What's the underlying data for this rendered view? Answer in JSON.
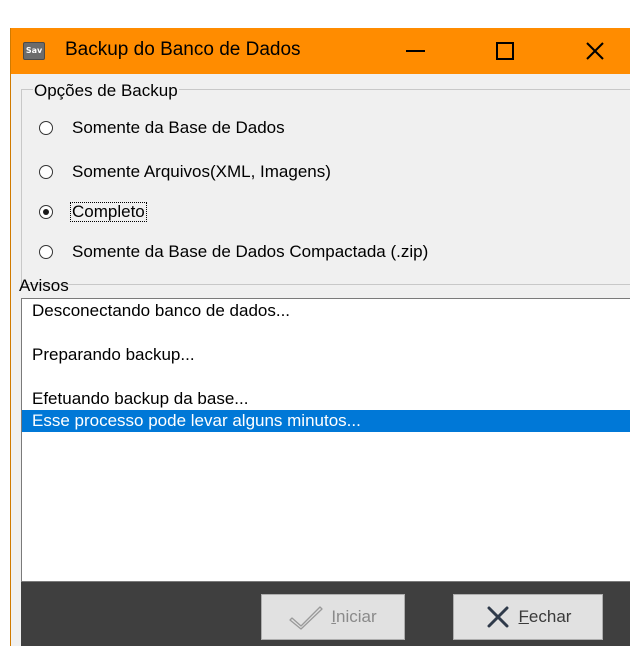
{
  "window": {
    "app_icon_text": "Sav",
    "title": "Backup do Banco de Dados"
  },
  "options": {
    "legend": "Opções de Backup",
    "items": [
      {
        "label": "Somente da Base de Dados",
        "checked": false
      },
      {
        "label": "Somente Arquivos(XML, Imagens)",
        "checked": false
      },
      {
        "label": "Completo",
        "checked": true
      },
      {
        "label": "Somente da Base de Dados Compactada (.zip)",
        "checked": false
      }
    ]
  },
  "avisos": {
    "label": "Avisos",
    "lines": [
      {
        "text": "Desconectando banco de dados...",
        "selected": false
      },
      {
        "text": "",
        "selected": false
      },
      {
        "text": "Preparando backup...",
        "selected": false
      },
      {
        "text": "",
        "selected": false
      },
      {
        "text": "Efetuando backup da base...",
        "selected": false
      },
      {
        "text": "Esse processo pode levar alguns minutos...",
        "selected": true
      }
    ]
  },
  "buttons": {
    "iniciar": {
      "accel": "I",
      "rest": "niciar",
      "enabled": false,
      "icon": "checkmark-icon"
    },
    "fechar": {
      "accel": "F",
      "rest": "echar",
      "enabled": true,
      "icon": "close-x-icon"
    }
  },
  "colors": {
    "titlebar": "#ff8c00",
    "selection": "#0078d7",
    "button_bar": "#3f3f3f"
  }
}
